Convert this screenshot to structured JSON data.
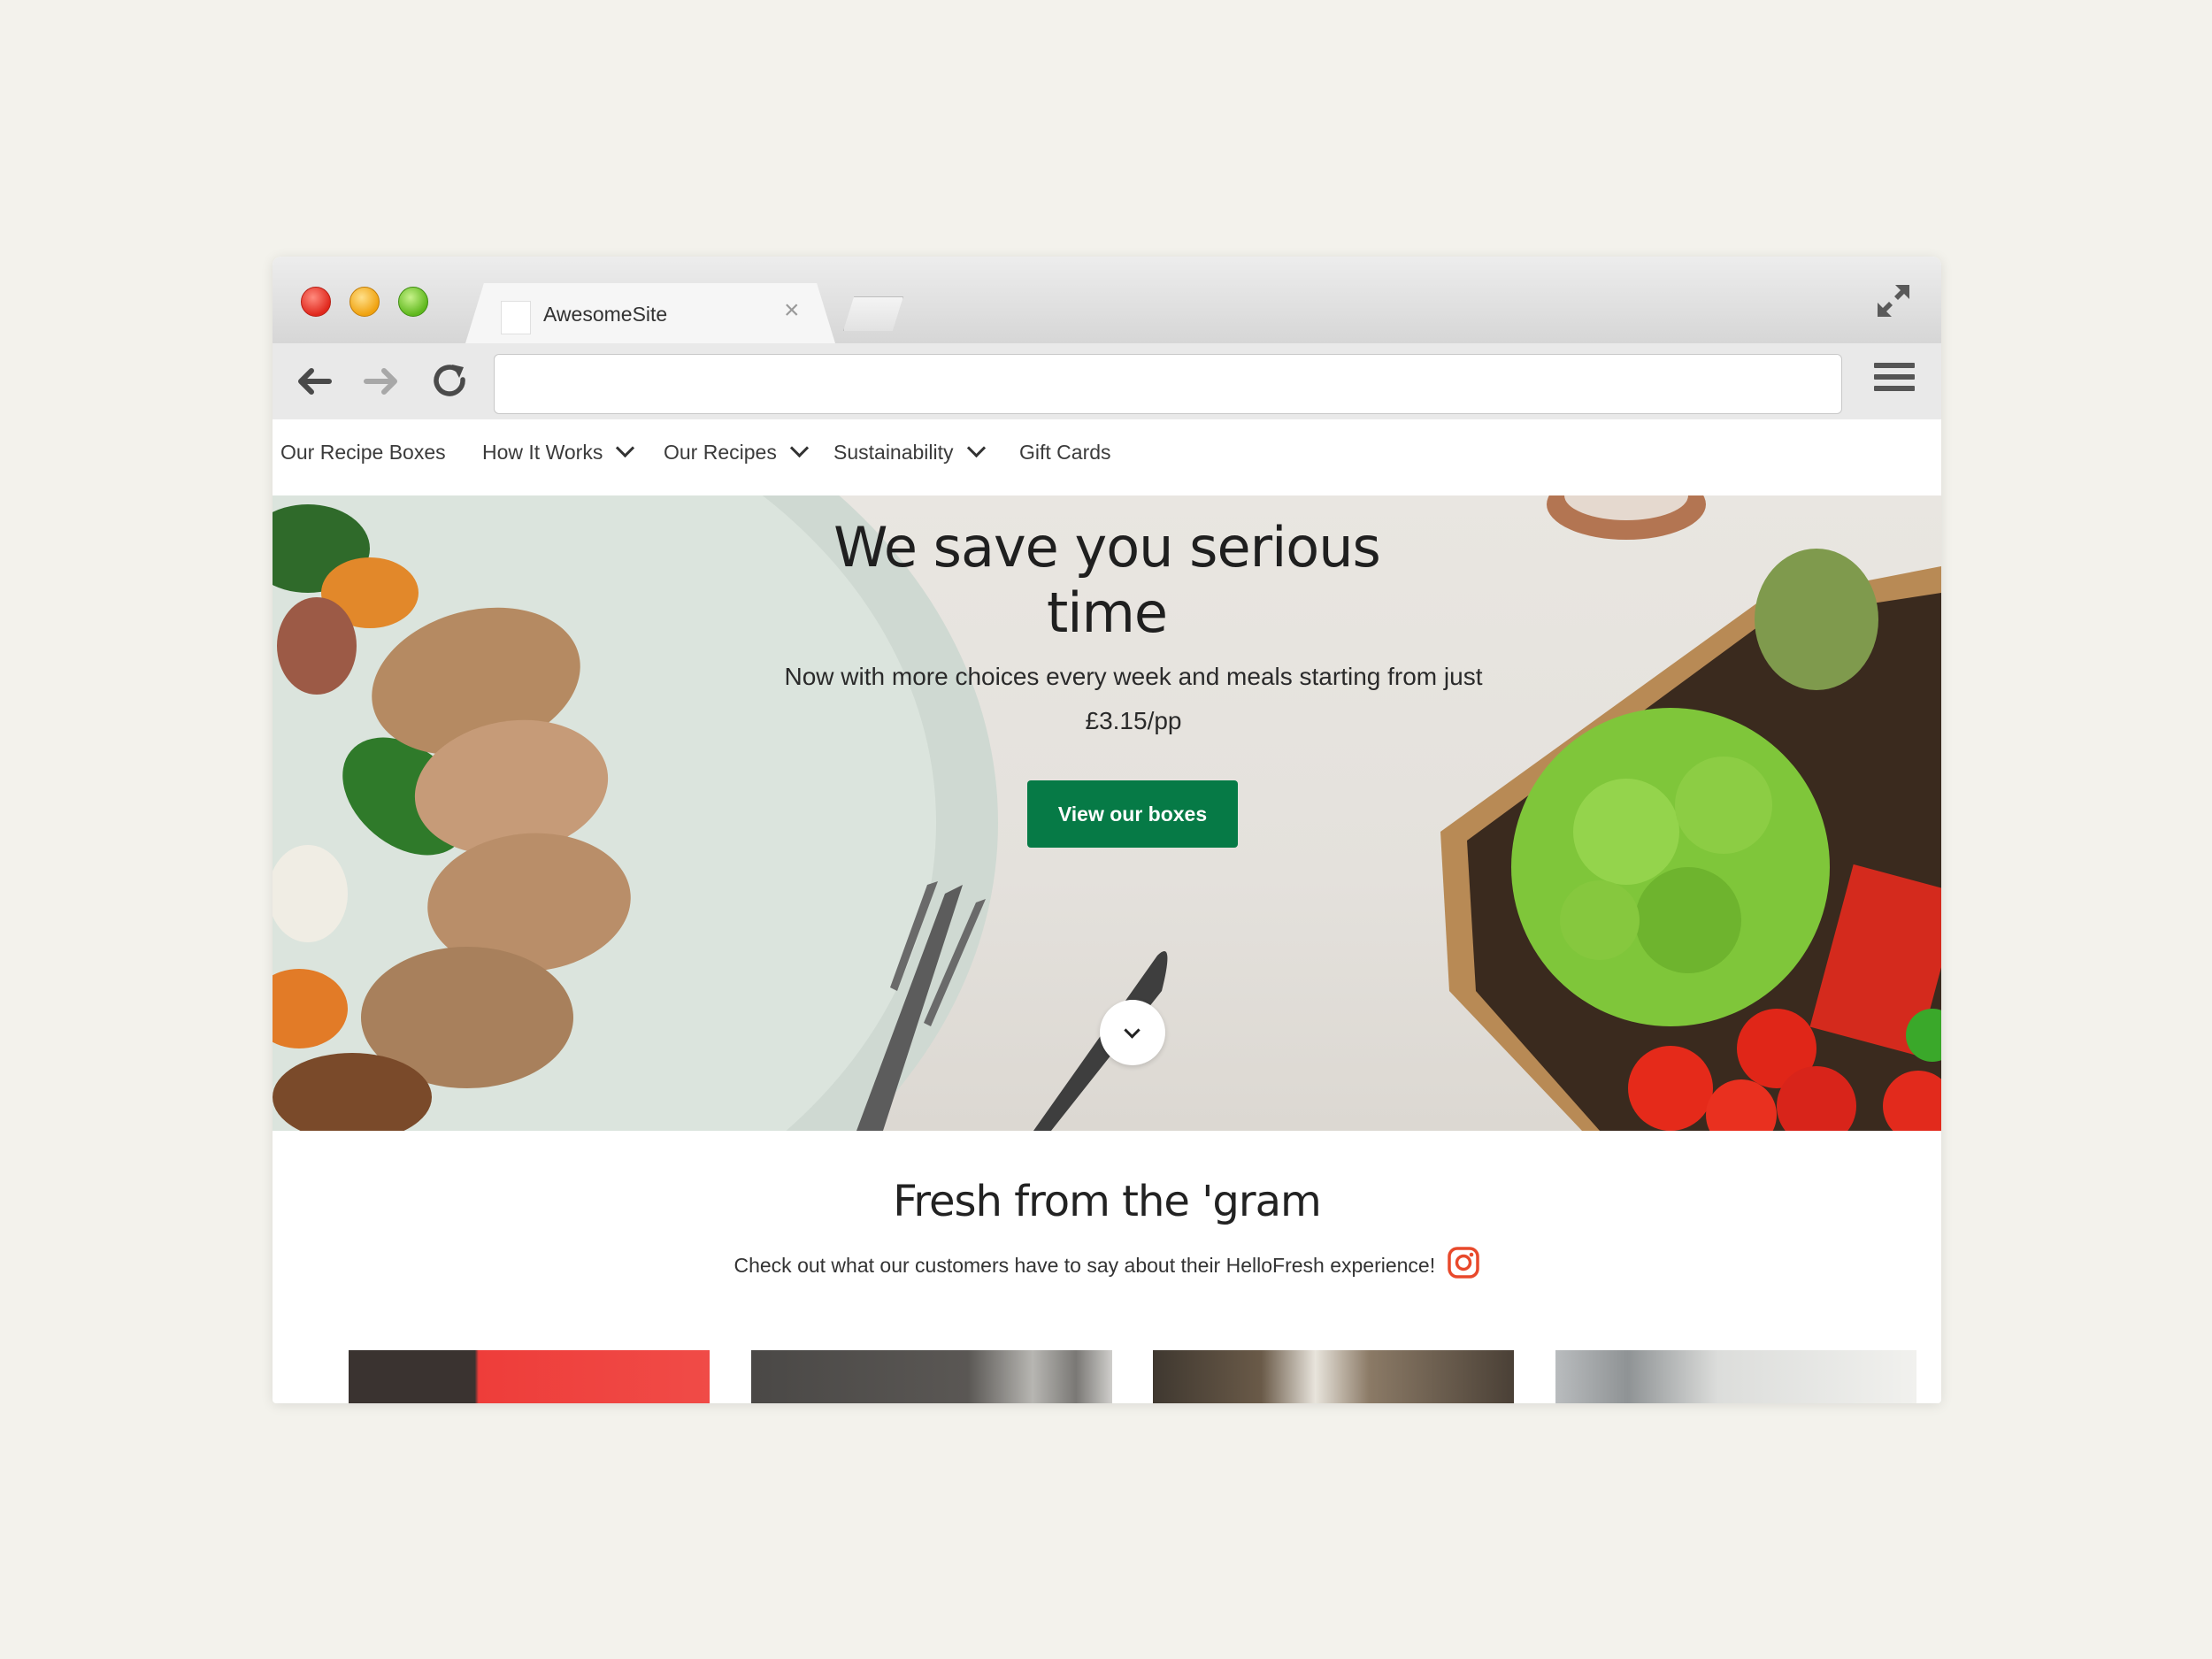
{
  "browser": {
    "tab_title": "AwesomeSite",
    "tab_close": "×",
    "url_value": "",
    "icons": [
      "back-arrow-icon",
      "forward-arrow-icon",
      "reload-icon",
      "hamburger-menu-icon",
      "expand-icon"
    ]
  },
  "nav": {
    "items": [
      {
        "label": "Our Recipe Boxes",
        "dropdown": false
      },
      {
        "label": "How It Works",
        "dropdown": true
      },
      {
        "label": "Our Recipes",
        "dropdown": true
      },
      {
        "label": "Sustainability",
        "dropdown": true
      },
      {
        "label": "Gift Cards",
        "dropdown": false
      }
    ]
  },
  "hero": {
    "title_line1": "We save you serious",
    "title_line2": "time",
    "subtitle": "Now with more choices every week and meals starting from just £3.15/pp",
    "cta_label": "View our boxes",
    "cta_color": "#067a46"
  },
  "gram": {
    "title": "Fresh from the 'gram",
    "subtitle": "Check out what our customers have to say about their HelloFresh experience!",
    "icon": "instagram-icon",
    "icon_color": "#e8492b"
  }
}
